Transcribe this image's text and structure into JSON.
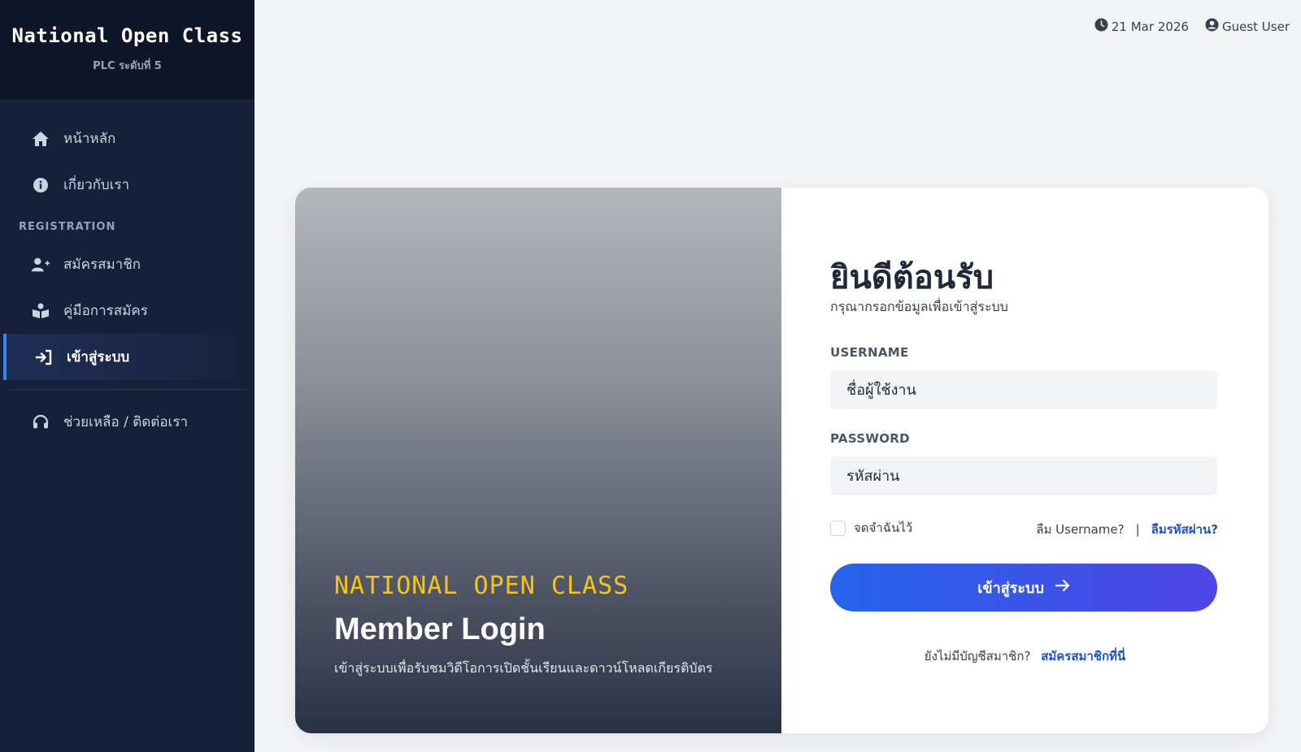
{
  "sidebar": {
    "brand": "National Open Class",
    "brand_sub": "PLC ระดับที่ 5",
    "items": [
      {
        "label": "หน้าหลัก",
        "icon": "home-icon"
      },
      {
        "label": "เกี่ยวกับเรา",
        "icon": "info-icon"
      }
    ],
    "section_label": "REGISTRATION",
    "registration_items": [
      {
        "label": "สมัครสมาชิก",
        "icon": "user-plus-icon"
      },
      {
        "label": "คู่มือการสมัคร",
        "icon": "book-reader-icon"
      },
      {
        "label": "เข้าสู่ระบบ",
        "icon": "sign-in-icon",
        "active": true
      }
    ],
    "help": {
      "label": "ช่วยเหลือ / ติดต่อเรา",
      "icon": "headset-icon"
    }
  },
  "topbar": {
    "date": "21 Mar 2026",
    "user": "Guest User"
  },
  "hero": {
    "eyebrow": "NATIONAL OPEN CLASS",
    "title": "Member Login",
    "description": "เข้าสู่ระบบเพื่อรับชมวิดีโอการเปิดชั้นเรียนและดาวน์โหลดเกียรติบัตร"
  },
  "form": {
    "welcome": "ยินดีต้อนรับ",
    "welcome_sub": "กรุณากรอกข้อมูลเพื่อเข้าสู่ระบบ",
    "username_label": "USERNAME",
    "username_placeholder": "ชื่อผู้ใช้งาน",
    "password_label": "PASSWORD",
    "password_placeholder": "รหัสผ่าน",
    "remember_label": "จดจำฉันไว้",
    "forgot_username": "ลืม Username?",
    "separator": "|",
    "forgot_password": "ลืมรหัสผ่าน?",
    "submit_label": "เข้าสู่ระบบ",
    "no_account": "ยังไม่มีบัญชีสมาชิก?",
    "signup_link": "สมัครสมาชิกที่นี่"
  },
  "colors": {
    "sidebar_bg": "#17203a",
    "accent": "#3b82f6",
    "eyebrow": "#f5c518",
    "link": "#1d4ed8",
    "button_start": "#2563eb",
    "button_end": "#4f46e5"
  }
}
